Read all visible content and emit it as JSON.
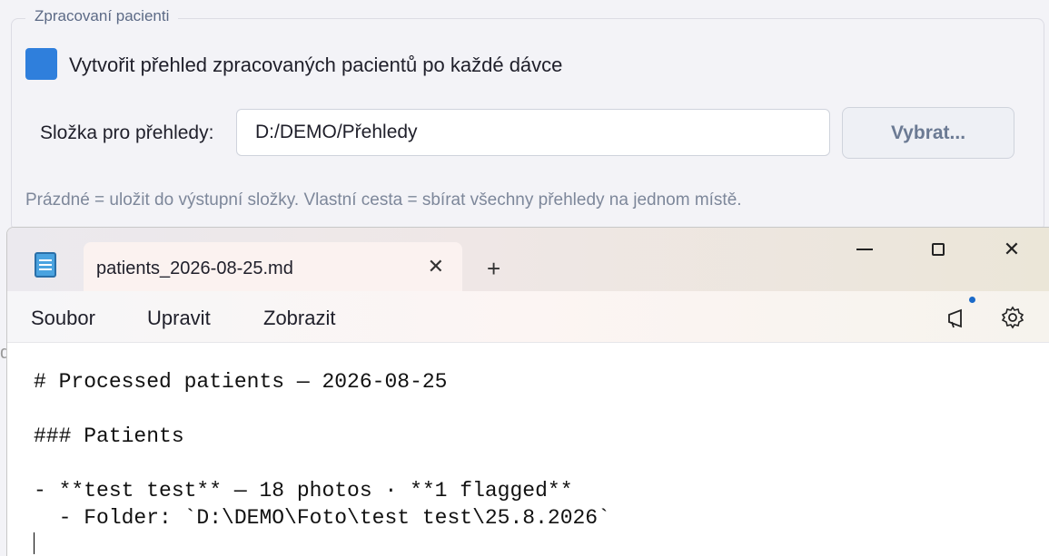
{
  "settings": {
    "group_title": "Zpracovaní pacienti",
    "checkbox_label": "Vytvořit přehled zpracovaných pacientů po každé dávce",
    "checkbox_checked": true,
    "folder_label": "Složka pro přehledy:",
    "folder_value": "D:/DEMO/Přehledy",
    "choose_button": "Vybrat...",
    "hint": "Prázdné = uložit do výstupní složky. Vlastní cesta = sbírat všechny přehledy na jednom místě."
  },
  "notepad": {
    "tab_title": "patients_2026-08-25.md",
    "tab_close_icon": "close-icon",
    "new_tab_label": "+",
    "menu": [
      "Soubor",
      "Upravit",
      "Zobrazit"
    ],
    "toolbar_icons": [
      "megaphone-icon",
      "gear-icon"
    ],
    "lines": [
      "# Processed patients — 2026-08-25",
      "",
      "### Patients",
      "",
      "- **test test** — 18 photos · **1 flagged**",
      "  - Folder: `D:\\DEMO\\Foto\\test test\\25.8.2026`"
    ]
  },
  "colors": {
    "accent": "#2f7fdc",
    "hint_text": "#7d879a",
    "notification_dot": "#1b6ac9"
  }
}
